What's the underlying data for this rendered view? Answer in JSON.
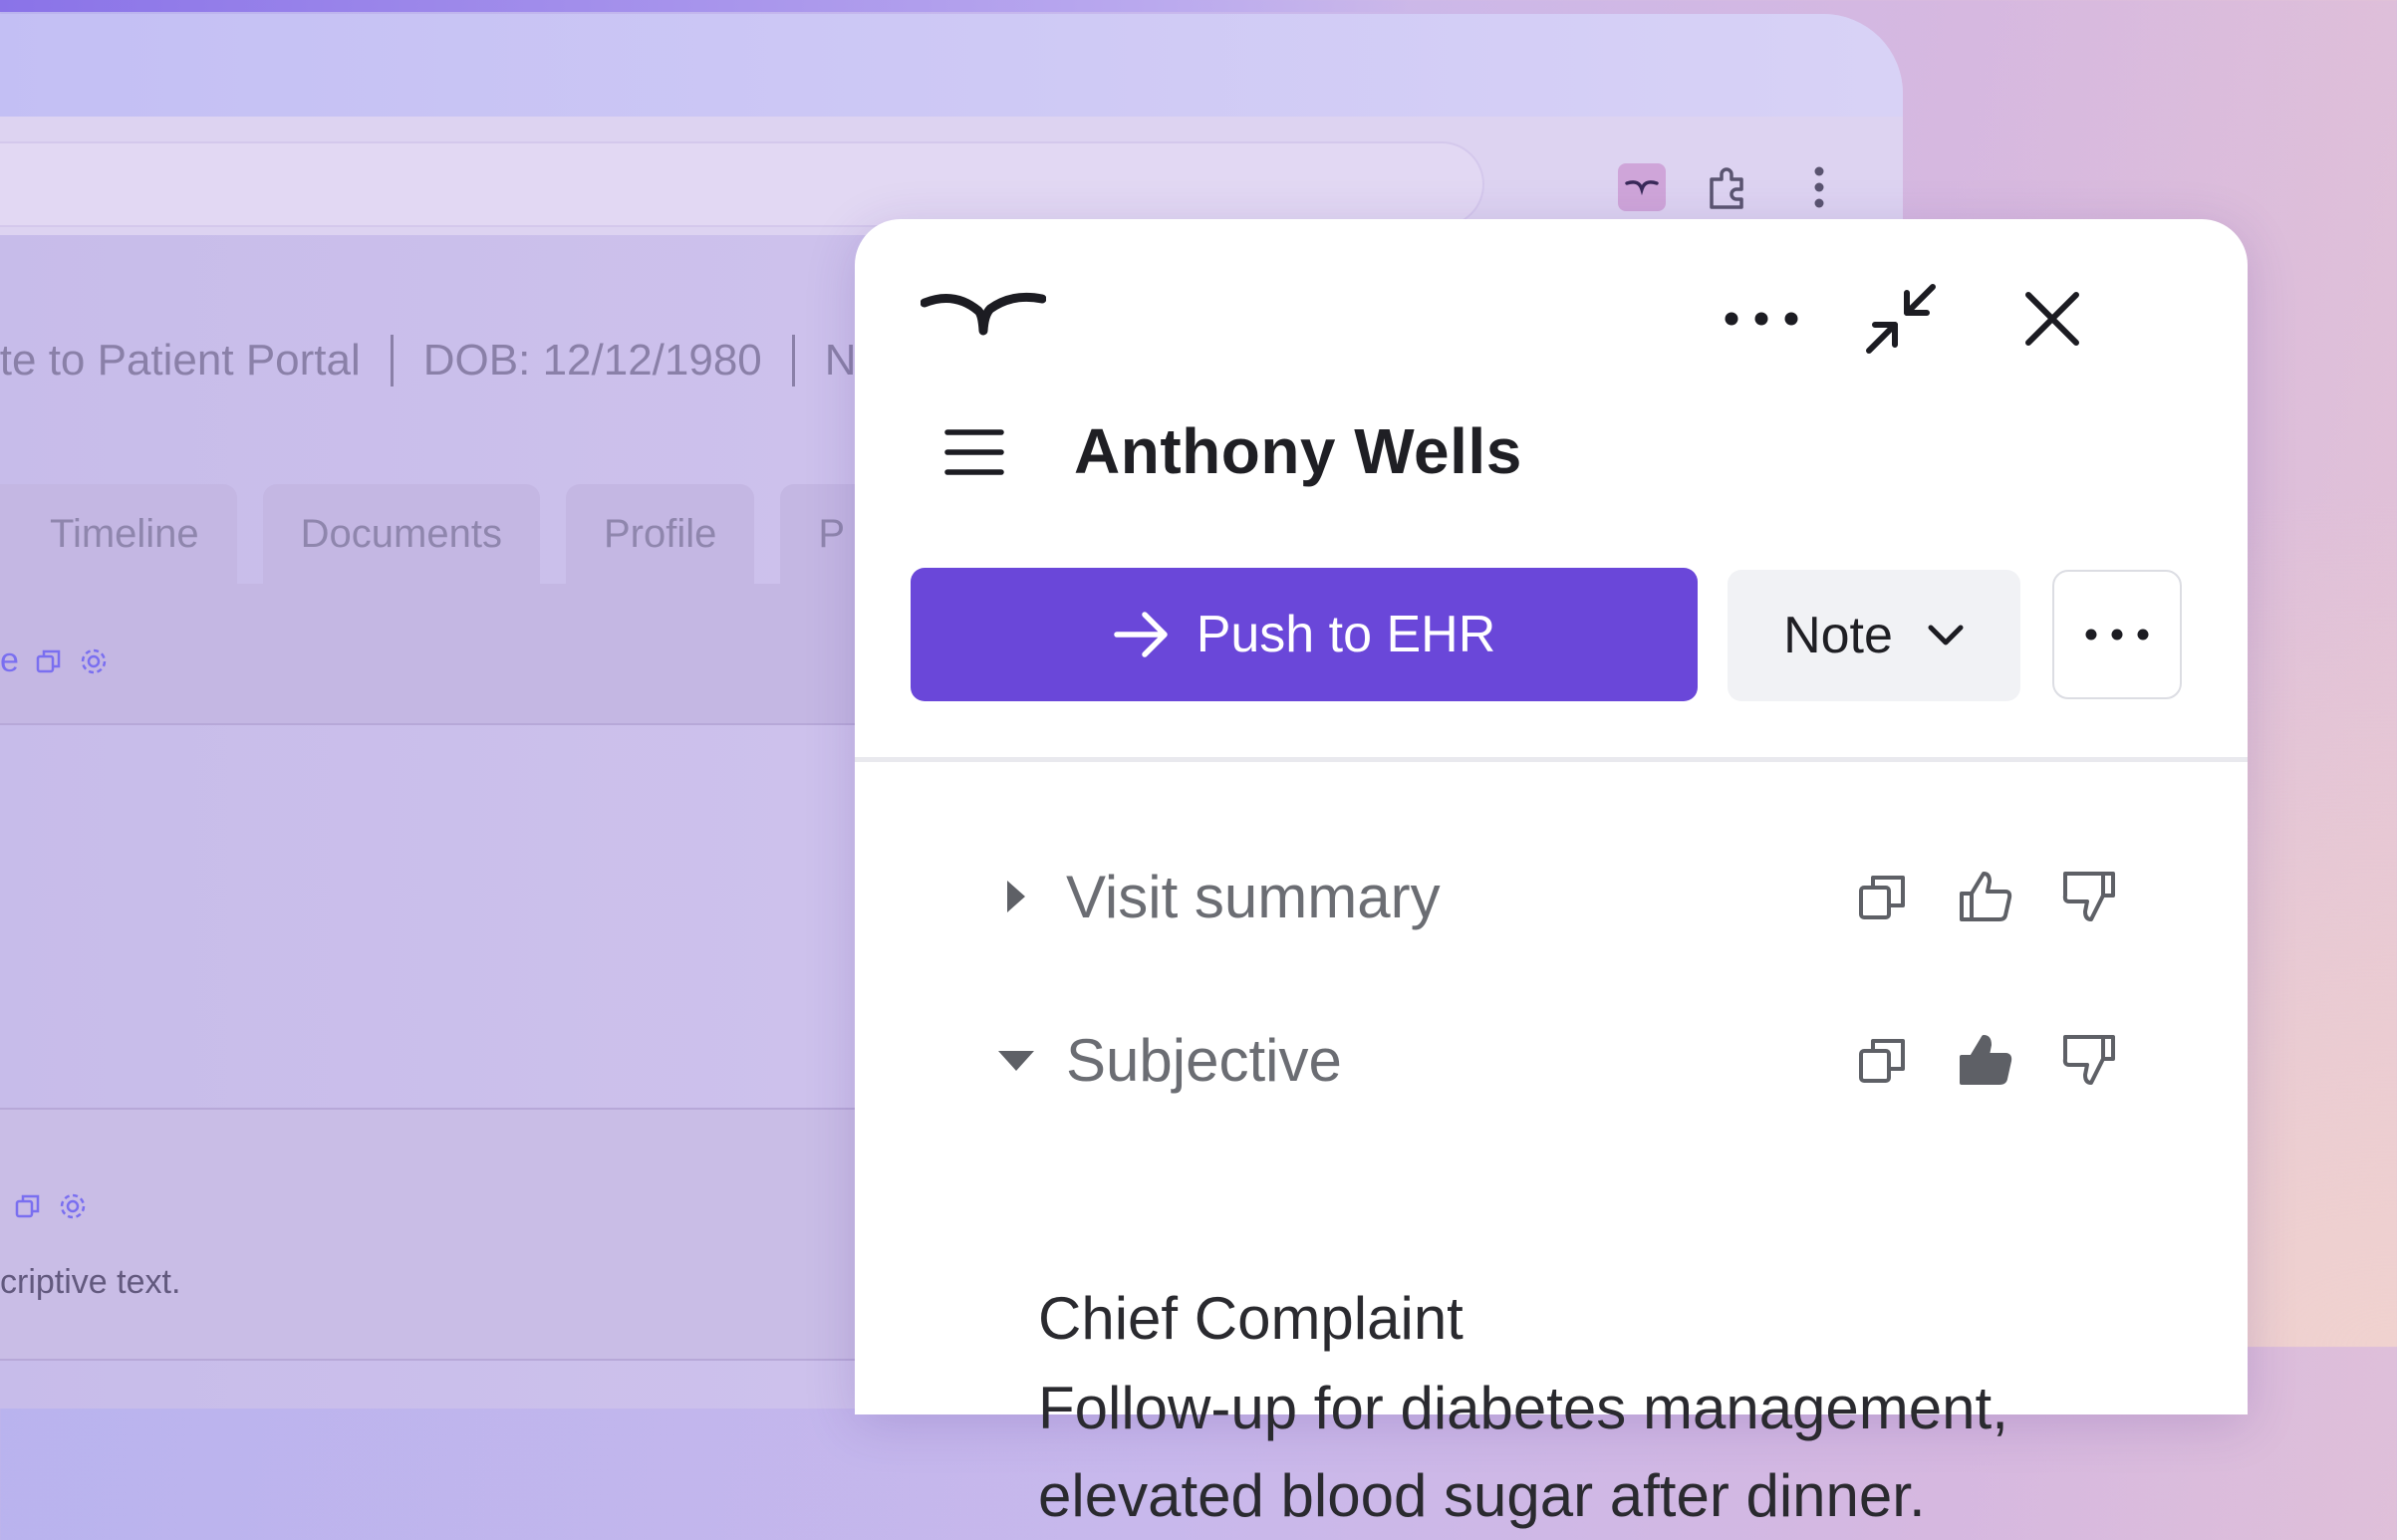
{
  "background": {
    "info_line": {
      "portal": "ite to Patient Portal",
      "dob": "DOB: 12/12/1980",
      "trail": "N"
    },
    "tabs": [
      "Timeline",
      "Documents",
      "Profile",
      "P"
    ],
    "tool_fragment": "e",
    "description": "criptive text."
  },
  "panel": {
    "patient_name": "Anthony Wells",
    "push_button_label": "Push to EHR",
    "note_select_value": "Note",
    "sections": [
      {
        "title": "Visit summary",
        "expanded": false,
        "feedback": "none"
      },
      {
        "title": "Subjective",
        "expanded": true,
        "feedback": "thumbs-up"
      }
    ],
    "chief_complaint_heading": "Chief Complaint",
    "chief_complaint_text": "Follow-up for diabetes management, elevated blood sugar after dinner."
  },
  "colors": {
    "accent": "#6a47d9",
    "panel_bg": "#ffffff",
    "title_text": "#1f1f24",
    "muted_text": "#6b6d73"
  }
}
